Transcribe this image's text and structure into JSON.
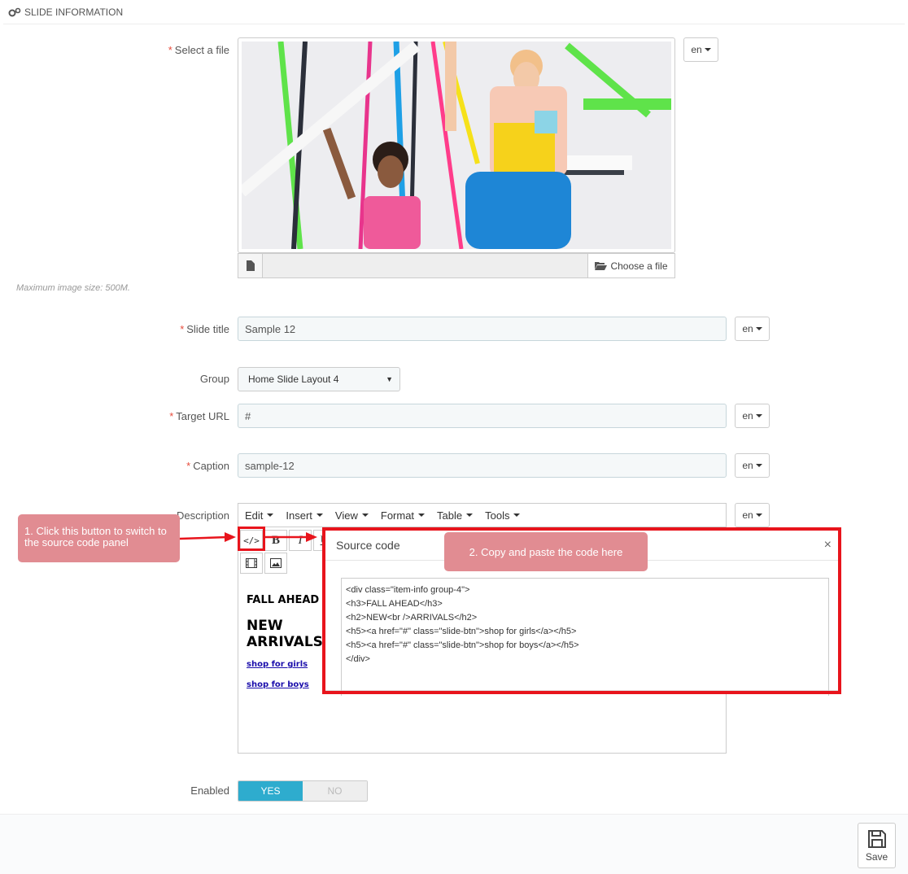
{
  "panel": {
    "title": "SLIDE INFORMATION"
  },
  "file": {
    "label": "Select a file",
    "choose_label": "Choose a file",
    "hint": "Maximum image size: 500M."
  },
  "lang": {
    "code": "en"
  },
  "title_field": {
    "label": "Slide title",
    "value": "Sample 12"
  },
  "group": {
    "label": "Group",
    "value": "Home Slide Layout 4"
  },
  "target": {
    "label": "Target URL",
    "value": "#"
  },
  "caption": {
    "label": "Caption",
    "value": "sample-12"
  },
  "description": {
    "label": "Description",
    "menu": [
      "Edit",
      "Insert",
      "View",
      "Format",
      "Table",
      "Tools"
    ],
    "preview": {
      "h3": "FALL AHEAD",
      "h2_line1": "NEW",
      "h2_line2": "ARRIVALS",
      "link1": "shop for girls",
      "link2": "shop for boys"
    }
  },
  "modal": {
    "title": "Source code",
    "close": "×",
    "code": "<div class=\"item-info group-4\">\n<h3>FALL AHEAD</h3>\n<h2>NEW<br />ARRIVALS</h2>\n<h5><a href=\"#\" class=\"slide-btn\">shop for girls</a></h5>\n<h5><a href=\"#\" class=\"slide-btn\">shop for boys</a></h5>\n</div>"
  },
  "callouts": {
    "step1": "1. Click this button to switch to the source code panel",
    "step2": "2. Copy and paste the code here"
  },
  "enabled": {
    "label": "Enabled",
    "yes": "YES",
    "no": "NO",
    "value": "YES"
  },
  "save": {
    "label": "Save"
  },
  "colors": {
    "accent": "#2eacce",
    "required": "#e74c3c",
    "highlight": "#e8141c",
    "callout": "#e18c92"
  }
}
